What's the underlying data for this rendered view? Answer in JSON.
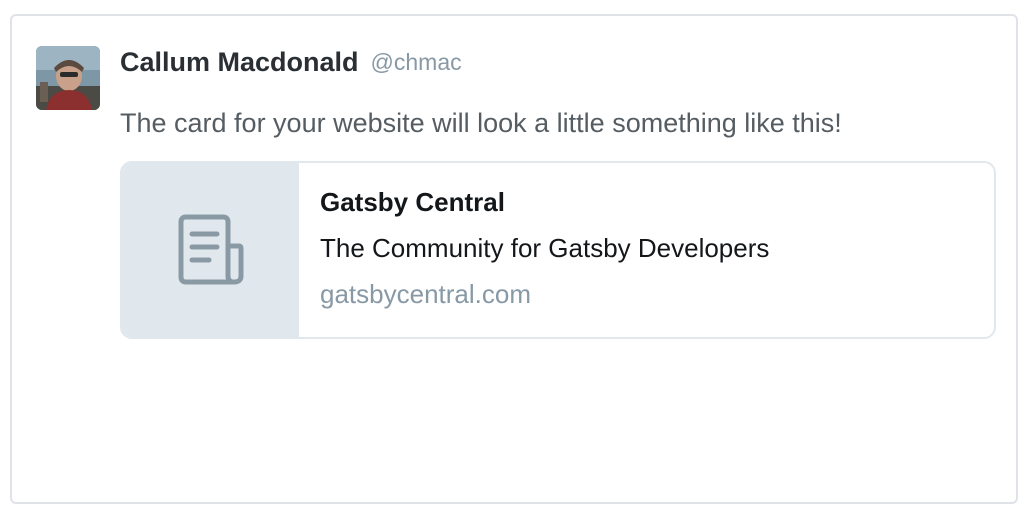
{
  "tweet": {
    "author": {
      "name": "Callum Macdonald",
      "handle": "@chmac"
    },
    "text": "The card for your website will look a little something like this!",
    "card": {
      "media_icon": "document-icon",
      "title": "Gatsby Central",
      "description": "The Community for Gatsby Developers",
      "domain": "gatsbycentral.com"
    }
  },
  "colors": {
    "name": "#292f33",
    "handle": "#8899a6",
    "text": "#555d63",
    "card_border": "#e1e8ed",
    "card_media_bg": "#e1e8ed",
    "icon": "#8a9aa5"
  }
}
